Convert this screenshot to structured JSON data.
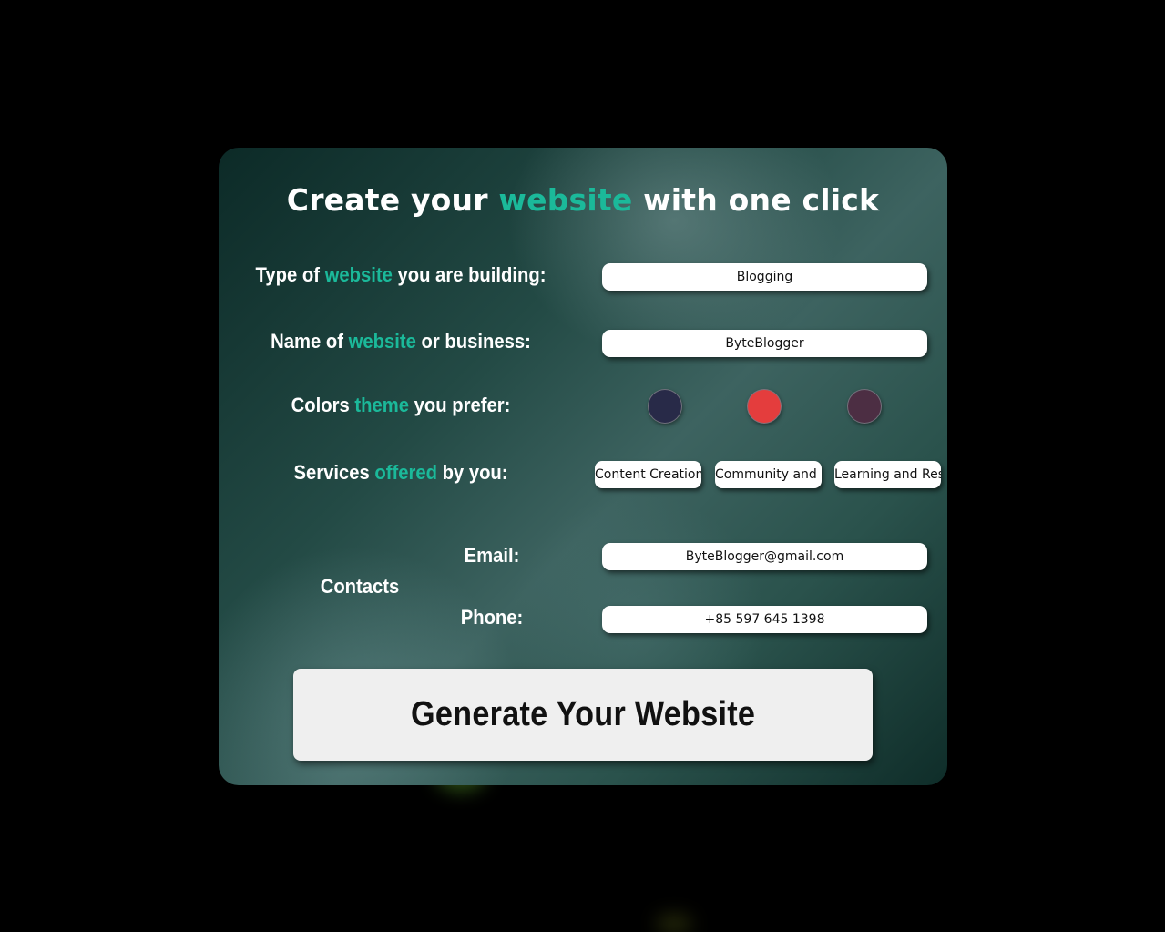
{
  "title": {
    "part1": "Create your ",
    "accent": "website",
    "part2": " with one click"
  },
  "type_label": {
    "part1": "Type of ",
    "accent": "website",
    "part2": " you are building:"
  },
  "type_value": "Blogging",
  "name_label": {
    "part1": "Name of ",
    "accent": "website",
    "part2": " or business:"
  },
  "name_value": "ByteBlogger",
  "colors_label": {
    "part1": "Colors ",
    "accent": "theme",
    "part2": " you prefer:"
  },
  "theme_colors": [
    "#282a48",
    "#e43d3d",
    "#4c2e43"
  ],
  "services_label": {
    "part1": "Services ",
    "accent": "offered",
    "part2": " by you:"
  },
  "services": [
    "Content Creation",
    "Community and E",
    "Learning and Res"
  ],
  "contacts": {
    "label": "Contacts",
    "email_label": "Email:",
    "email_value": "ByteBlogger@gmail.com",
    "phone_label": "Phone:",
    "phone_value": "+85 597 645 1398"
  },
  "generate_label": "Generate Your Website",
  "colors": {
    "accent": "#1bb99a",
    "background": "#000000",
    "card_dark": "#0c2a27",
    "card_light": "#3d6360"
  }
}
